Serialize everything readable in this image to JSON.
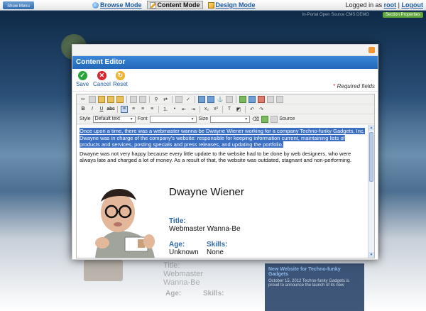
{
  "topbar": {
    "show_menu": "Show Menu",
    "modes": [
      {
        "label": "Browse Mode",
        "icon": "globe-icon"
      },
      {
        "label": "Content Mode",
        "icon": "pencil-icon"
      },
      {
        "label": "Design Mode",
        "icon": "brush-icon"
      }
    ],
    "logged_in_text": "Logged in as",
    "user": "root",
    "separator": "|",
    "logout": "Logout"
  },
  "site": {
    "label": "In-Portal Open Source CMS DEMO",
    "badge": "Section Properties",
    "below": {
      "title_label": "Title:",
      "title_value": "Webmaster Wanna-Be",
      "age_label": "Age:",
      "skills_label": "Skills:"
    },
    "news": {
      "title": "New Website for Techno-funky Gadgets",
      "text": "October 15, 2012 Techno-funky Gadgets is proud to announce the launch of its new"
    }
  },
  "dialog": {
    "title": "Content Editor",
    "actions": [
      {
        "label": "Save",
        "icon": "save-icon"
      },
      {
        "label": "Cancel",
        "icon": "cancel-icon"
      },
      {
        "label": "Reset",
        "icon": "reset-icon"
      }
    ],
    "required_marker": "*",
    "required_text": "Required fields"
  },
  "editor": {
    "style_label": "Style",
    "style_value": "Default text",
    "font_label": "Font",
    "font_value": "",
    "size_label": "Size",
    "size_value": "",
    "source_label": "Source",
    "content": {
      "paragraph1": "Once upon a time, there was a webmaster wanna-be Dwayne Wiener working for a company Techno-funky Gadgets, Inc. Dwayne was in charge of the company's website: responsible for keeping information current, maintaining lists of products and services, posting specials and press releases, and updating the portfolio.",
      "paragraph2": "Dwayne was not very happy because every little update to the website had to be done by web designers, who were always late and charged a lot of money. As a result of that, the website was outdated, stagnant and non-performing.",
      "name": "Dwayne Wiener",
      "title_label": "Title:",
      "title_value": "Webmaster Wanna-Be",
      "age_label": "Age:",
      "age_value": "Unknown",
      "skills_label": "Skills:",
      "skills_value": "None"
    }
  },
  "colors": {
    "accent": "#2367b8",
    "selection": "#3a6fc4",
    "label_blue": "#2f6aab"
  }
}
